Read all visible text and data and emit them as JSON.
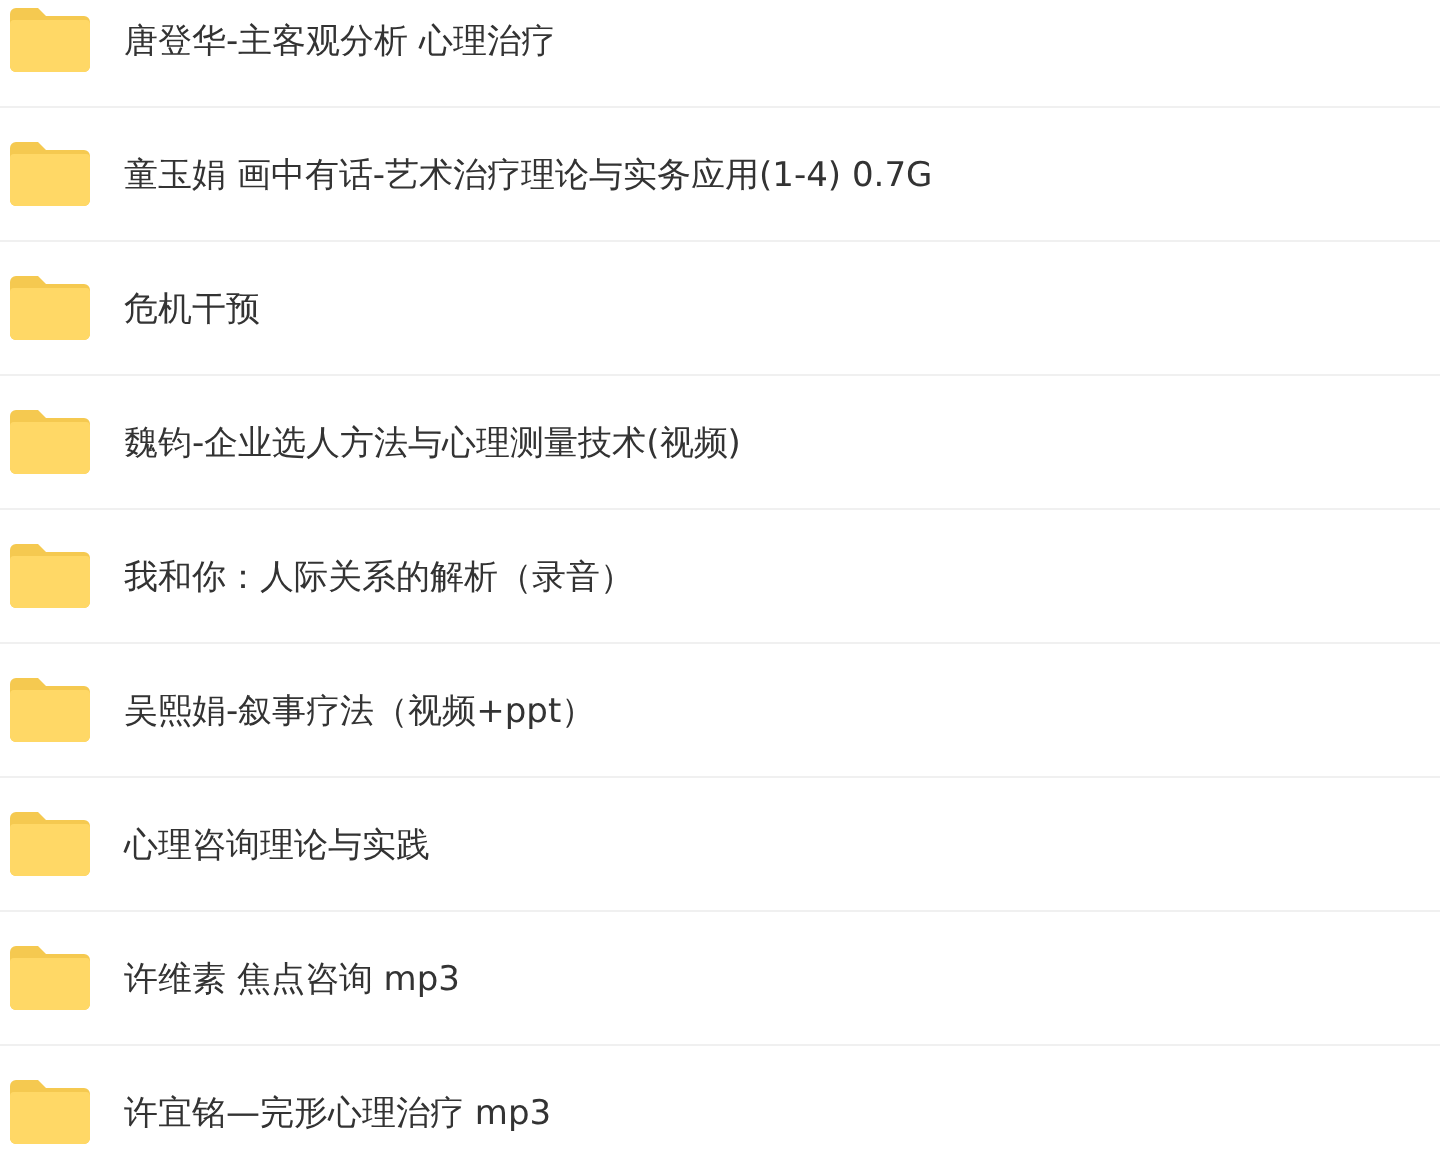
{
  "folders": [
    {
      "name": "唐登华-主客观分析 心理治疗"
    },
    {
      "name": "童玉娟 画中有话-艺术治疗理论与实务应用(1-4) 0.7G"
    },
    {
      "name": "危机干预"
    },
    {
      "name": "魏钧-企业选人方法与心理测量技术(视频)"
    },
    {
      "name": "我和你：人际关系的解析（录音）"
    },
    {
      "name": "吴熙娟-叙事疗法（视频+ppt）"
    },
    {
      "name": "心理咨询理论与实践"
    },
    {
      "name": "许维素 焦点咨询 mp3"
    },
    {
      "name": "许宜铭—完形心理治疗 mp3"
    }
  ]
}
